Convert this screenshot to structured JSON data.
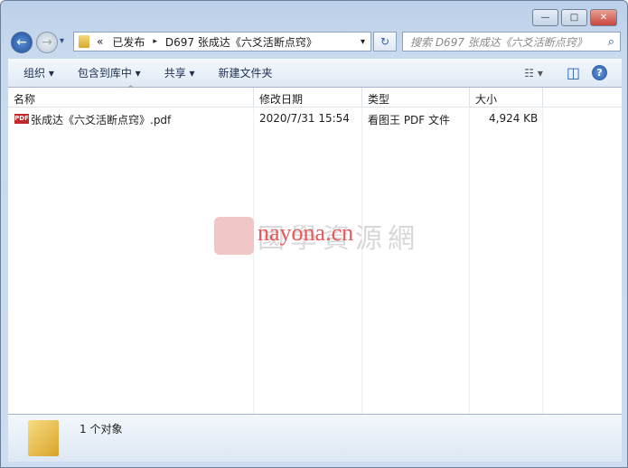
{
  "window": {
    "minimize": "—",
    "maximize": "□",
    "close": "✕",
    "close_color": "#c9463d"
  },
  "nav": {
    "back": "←",
    "forward": "→",
    "recent": "▾"
  },
  "address": {
    "overflow": "«",
    "crumbs": [
      "已发布",
      "D697 张成达《六爻活断点窍》"
    ],
    "sep": "▸",
    "dropdown": "▾",
    "refresh": "↻"
  },
  "search": {
    "placeholder": "搜索 D697 张成达《六爻活断点窍》",
    "icon": "search-icon"
  },
  "toolbar": {
    "organize": "组织 ▾",
    "include_library": "包含到库中 ▾",
    "share": "共享 ▾",
    "new_folder": "新建文件夹",
    "view": "☷ ▾",
    "preview": "◫",
    "help": "?"
  },
  "columns": {
    "name": "名称",
    "date": "修改日期",
    "type": "类型",
    "size": "大小",
    "sort": "^"
  },
  "files": [
    {
      "icon": "pdf-icon",
      "name": "张成达《六爻活断点窍》.pdf",
      "date": "2020/7/31 15:54",
      "type": "看图王 PDF 文件",
      "size": "4,924 KB"
    }
  ],
  "watermark": {
    "logo": "國學",
    "text": "nayona.cn",
    "chinese": "國學資源網"
  },
  "status": {
    "count": "1 个对象"
  }
}
